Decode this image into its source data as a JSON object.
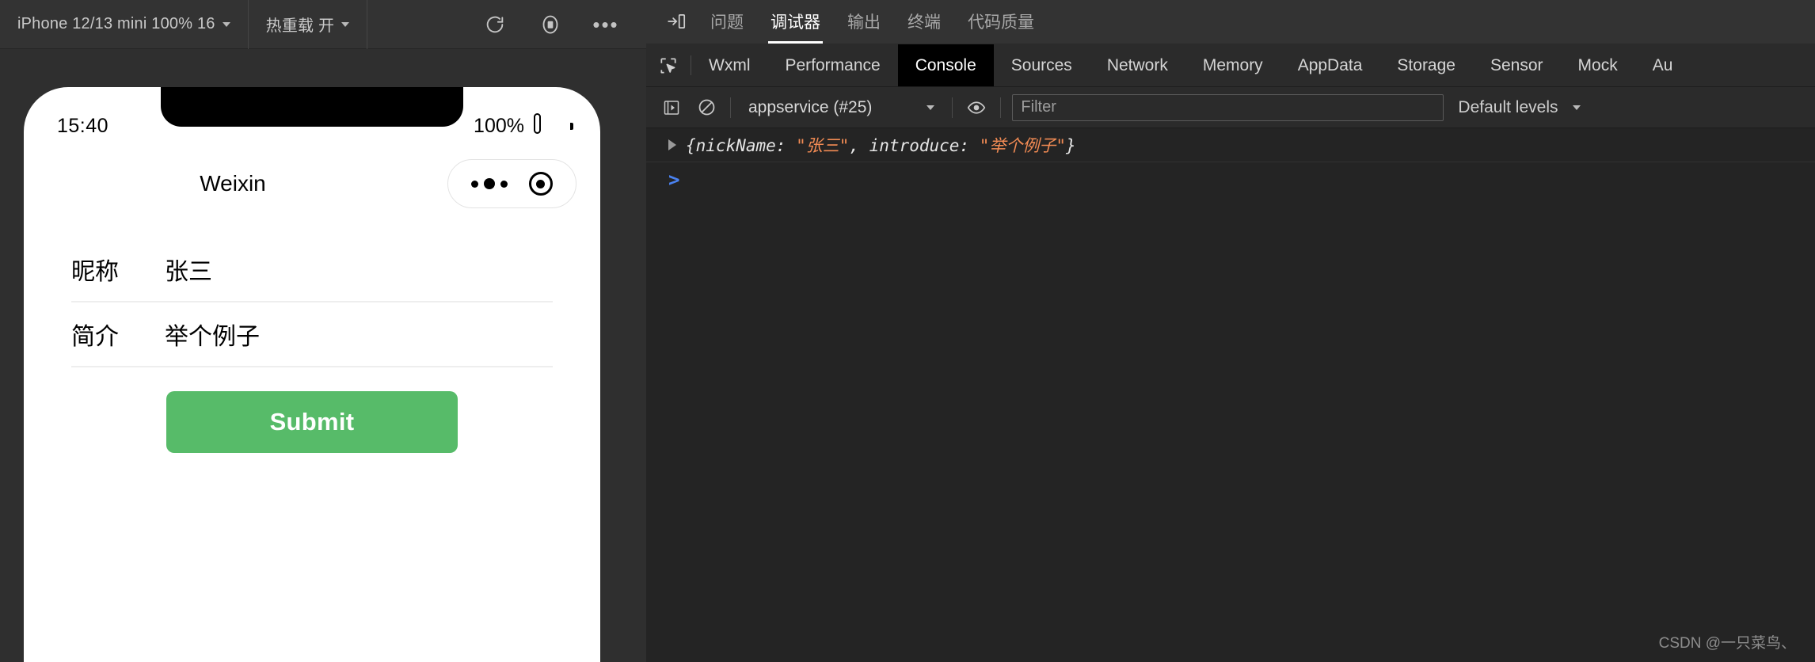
{
  "simulator": {
    "toolbar": {
      "device_label": "iPhone 12/13 mini 100% 16",
      "hot_reload_label": "热重载 开",
      "refresh_icon": "refresh-icon",
      "stop_icon": "stop-record-icon",
      "more_label": "•••"
    },
    "status_bar": {
      "time": "15:40",
      "battery_percent": "100%",
      "battery_icon": "battery-full-icon"
    },
    "navbar": {
      "title": "Weixin",
      "capsule_more_icon": "more-dots-icon",
      "capsule_target_icon": "target-circle-icon"
    },
    "form": {
      "rows": [
        {
          "label": "昵称",
          "value": "张三"
        },
        {
          "label": "简介",
          "value": "举个例子"
        }
      ],
      "submit_label": "Submit",
      "submit_color": "#57bb69"
    }
  },
  "devtools": {
    "top_bar": {
      "panel_icon": "toggle-panel-icon",
      "tabs": [
        {
          "label": "问题",
          "active": false
        },
        {
          "label": "调试器",
          "active": true
        },
        {
          "label": "输出",
          "active": false
        },
        {
          "label": "终端",
          "active": false
        },
        {
          "label": "代码质量",
          "active": false
        }
      ]
    },
    "tabs": {
      "inspect_icon": "inspect-cursor-icon",
      "items": [
        {
          "label": "Wxml",
          "active": false
        },
        {
          "label": "Performance",
          "active": false
        },
        {
          "label": "Console",
          "active": true
        },
        {
          "label": "Sources",
          "active": false
        },
        {
          "label": "Network",
          "active": false
        },
        {
          "label": "Memory",
          "active": false
        },
        {
          "label": "AppData",
          "active": false
        },
        {
          "label": "Storage",
          "active": false
        },
        {
          "label": "Sensor",
          "active": false
        },
        {
          "label": "Mock",
          "active": false
        },
        {
          "label": "Au",
          "active": false
        }
      ]
    },
    "console_toolbar": {
      "execute_icon": "execute-step-icon",
      "clear_icon": "clear-console-icon",
      "context_value": "appservice (#25)",
      "eye_icon": "live-expression-icon",
      "filter_value": "",
      "filter_placeholder": "Filter",
      "levels_label": "Default levels"
    },
    "console_output": {
      "entries": [
        {
          "disclosure_icon": "disclosure-triangle-icon",
          "prefix": "{nickName: ",
          "value1": "\"张三\"",
          "middle": ", introduce: ",
          "value2": "\"举个例子\"",
          "suffix": "}"
        }
      ],
      "prompt_caret": ">"
    },
    "watermark": "CSDN @一只菜鸟、"
  }
}
